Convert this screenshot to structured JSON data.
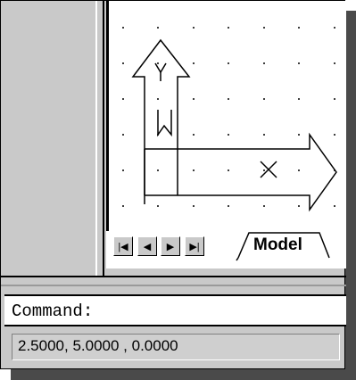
{
  "layout_tab": {
    "label": "Model"
  },
  "command_line": {
    "prompt": "Command:"
  },
  "status_bar": {
    "coordinates": "2.5000,  5.0000 ,  0.0000"
  },
  "ucs_icon": {
    "y_label": "Y",
    "x_label": "X",
    "w_label": "W"
  },
  "icons": {
    "first": "first-icon",
    "prev": "previous-icon",
    "next": "next-icon",
    "last": "last-icon"
  }
}
